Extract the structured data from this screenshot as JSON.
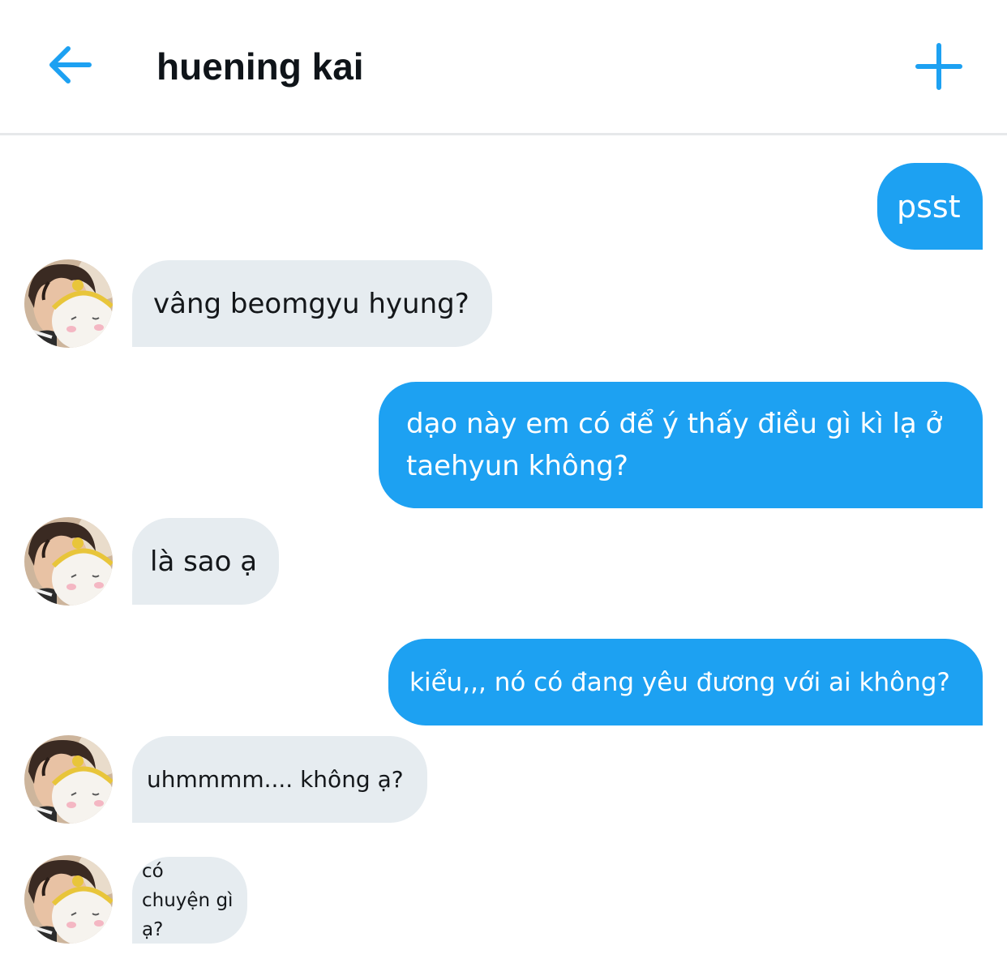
{
  "header": {
    "title": "huening kai",
    "back_icon": "arrow-left-icon",
    "new_icon": "plus-icon",
    "accent_color": "#1da1f2"
  },
  "messages": [
    {
      "direction": "outgoing",
      "text": "psst"
    },
    {
      "direction": "incoming",
      "text": "vâng beomgyu hyung?"
    },
    {
      "direction": "outgoing",
      "text": "dạo này em có để ý thấy điều gì kì lạ ở taehyun không?"
    },
    {
      "direction": "incoming",
      "text": "là sao ạ"
    },
    {
      "direction": "outgoing",
      "text": "kiểu,,, nó có đang yêu đương với ai không?"
    },
    {
      "direction": "incoming",
      "text": "uhmmmm.... không ạ?"
    },
    {
      "direction": "incoming",
      "text": "có chuyện gì ạ?"
    }
  ],
  "colors": {
    "outgoing_bubble": "#1da1f2",
    "incoming_bubble": "#e6ecf0"
  }
}
